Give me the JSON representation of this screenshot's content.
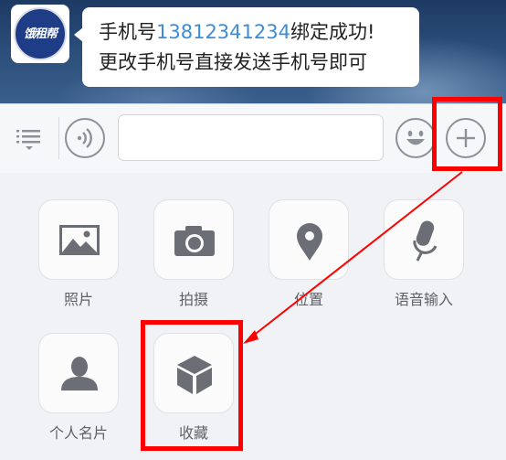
{
  "chat": {
    "avatar_text": "饿租帮",
    "message_line1_prefix": "手机号",
    "message_phone": "13812341234",
    "message_line1_suffix": "绑定成功!",
    "message_line2": "更改手机号直接发送手机号即可"
  },
  "input_bar": {
    "menu_icon": "list-menu-icon",
    "voice_icon": "voice-wave-icon",
    "text_value": "",
    "emoji_icon": "smiley-icon",
    "plus_icon": "plus-icon"
  },
  "panel": {
    "items": [
      {
        "label": "照片",
        "icon": "image-icon"
      },
      {
        "label": "拍摄",
        "icon": "camera-icon"
      },
      {
        "label": "位置",
        "icon": "map-pin-icon"
      },
      {
        "label": "语音输入",
        "icon": "microphone-icon"
      },
      {
        "label": "个人名片",
        "icon": "person-icon"
      },
      {
        "label": "收藏",
        "icon": "cube-icon"
      }
    ]
  },
  "colors": {
    "highlight": "#ff0000",
    "phone_link": "#3d8cd6",
    "icon_gray": "#6b6e74"
  }
}
